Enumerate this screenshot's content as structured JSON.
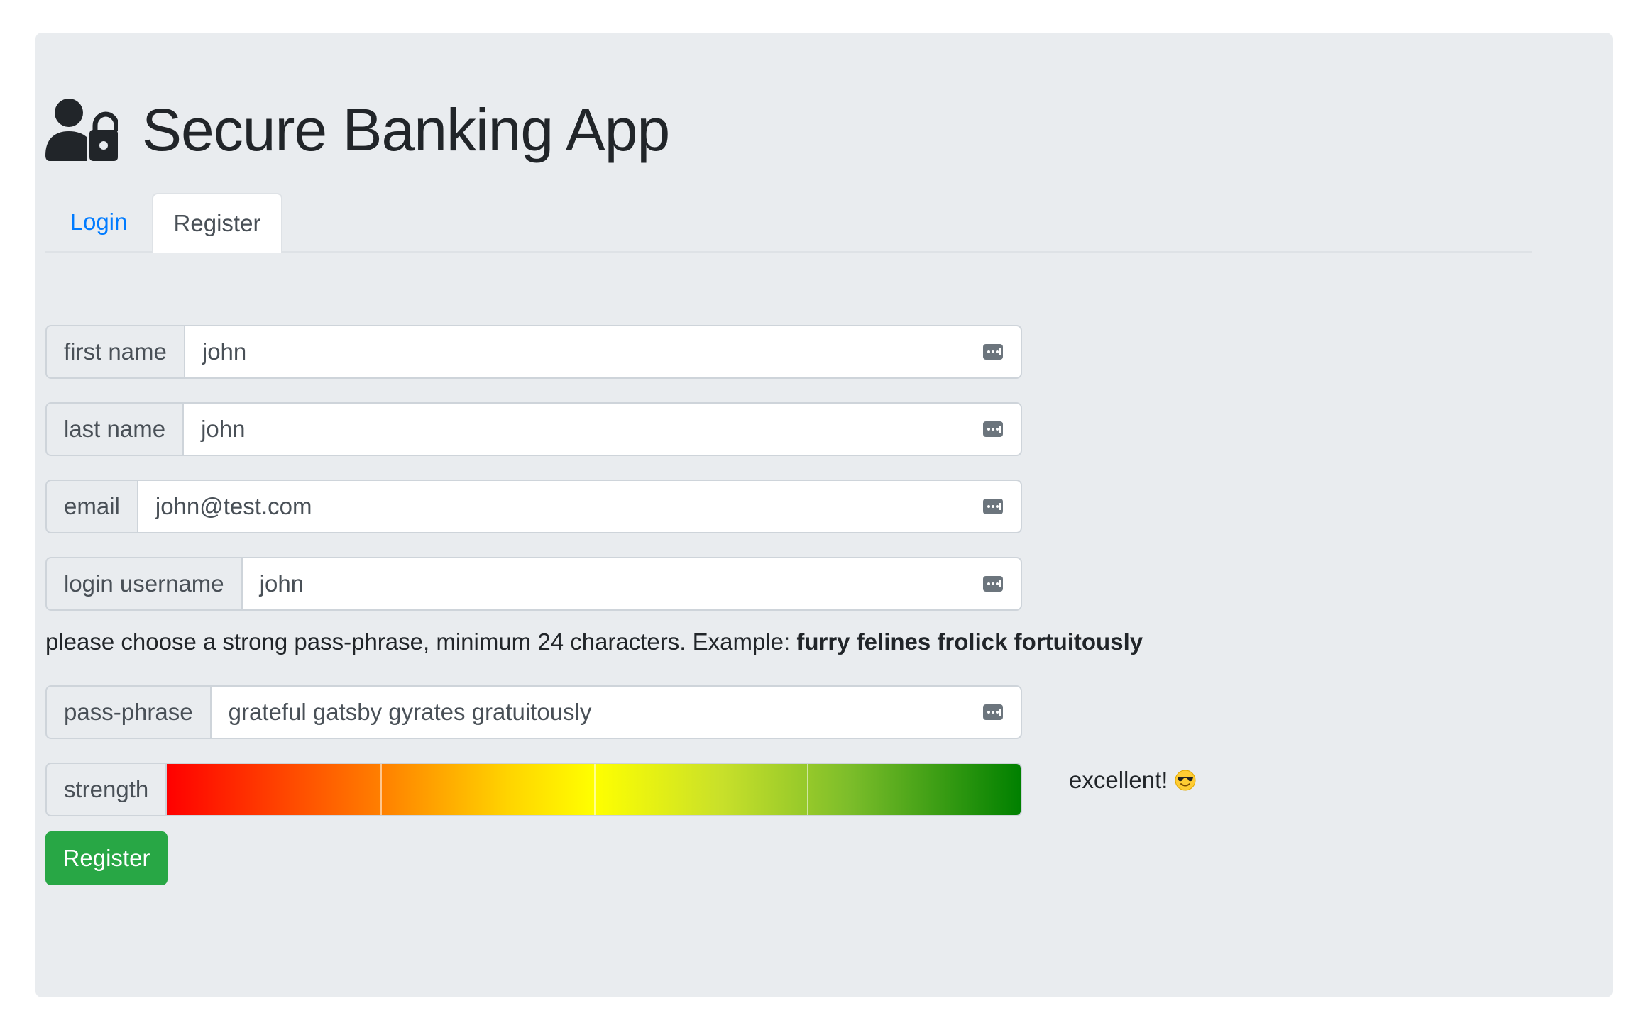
{
  "app": {
    "title": "Secure Banking App",
    "icon": "user-lock-icon"
  },
  "tabs": [
    {
      "label": "Login",
      "active": false
    },
    {
      "label": "Register",
      "active": true
    }
  ],
  "form": {
    "first_name": {
      "label": "first name",
      "value": "john"
    },
    "last_name": {
      "label": "last name",
      "value": "john"
    },
    "email": {
      "label": "email",
      "value": "john@test.com"
    },
    "username": {
      "label": "login username",
      "value": "john"
    },
    "hint_text": "please choose a strong pass-phrase, minimum 24 characters. Example: ",
    "hint_example": "furry felines frolick fortuitously",
    "passphrase": {
      "label": "pass-phrase",
      "value": "grateful gatsby gyrates gratuitously"
    },
    "strength": {
      "label": "strength",
      "level": 4,
      "max_level": 4,
      "result_text": "excellent!",
      "result_emoji": "smiling-face-with-sunglasses-icon"
    },
    "submit_label": "Register"
  },
  "colors": {
    "background": "#e9ecef",
    "tab_active_link": "#007bff",
    "button": "#28a745",
    "meter_start": "#ff0000",
    "meter_mid": "#ffff00",
    "meter_end": "#008000"
  }
}
